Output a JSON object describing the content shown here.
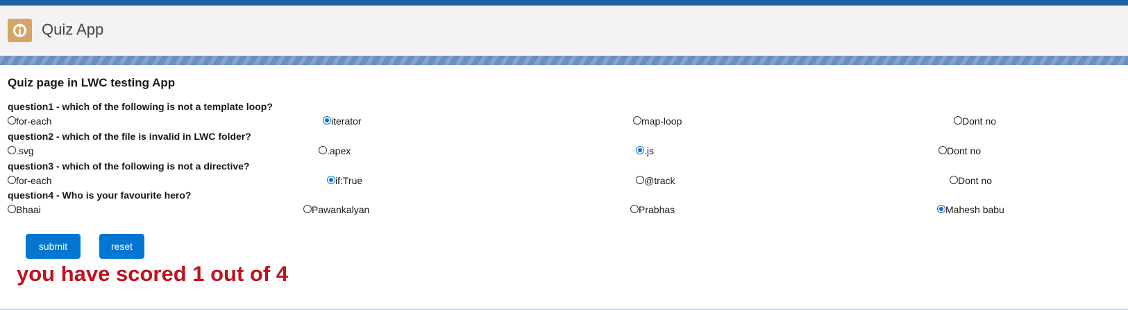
{
  "app": {
    "title": "Quiz App"
  },
  "page": {
    "title": "Quiz page in LWC testing App"
  },
  "questions": [
    {
      "label": "question1 - which of the following is not a template loop?",
      "options": [
        {
          "label": "for-each",
          "checked": false
        },
        {
          "label": "iterator",
          "checked": true
        },
        {
          "label": "map-loop",
          "checked": false
        },
        {
          "label": "Dont no",
          "checked": false
        }
      ]
    },
    {
      "label": "question2 - which of the file is invalid in LWC folder?",
      "options": [
        {
          "label": ".svg",
          "checked": false
        },
        {
          "label": ".apex",
          "checked": false
        },
        {
          "label": ".js",
          "checked": true
        },
        {
          "label": "Dont no",
          "checked": false
        }
      ]
    },
    {
      "label": "question3 - which of the following is not a directive?",
      "options": [
        {
          "label": "for-each",
          "checked": false
        },
        {
          "label": "if:True",
          "checked": true
        },
        {
          "label": "@track",
          "checked": false
        },
        {
          "label": "Dont no",
          "checked": false
        }
      ]
    },
    {
      "label": "question4 - Who is your favourite hero?",
      "options": [
        {
          "label": "Bhaai",
          "checked": false
        },
        {
          "label": "Pawankalyan",
          "checked": false
        },
        {
          "label": "Prabhas",
          "checked": false
        },
        {
          "label": "Mahesh babu",
          "checked": true
        }
      ]
    }
  ],
  "buttons": {
    "submit": "submit",
    "reset": "reset"
  },
  "result": {
    "text": "you have scored 1 out of 4"
  },
  "colors": {
    "accent": "#0176d3",
    "score": "#c0111f",
    "radio_checked": "#0b6fd6"
  },
  "icons": {
    "logo": "app-logo-icon"
  }
}
